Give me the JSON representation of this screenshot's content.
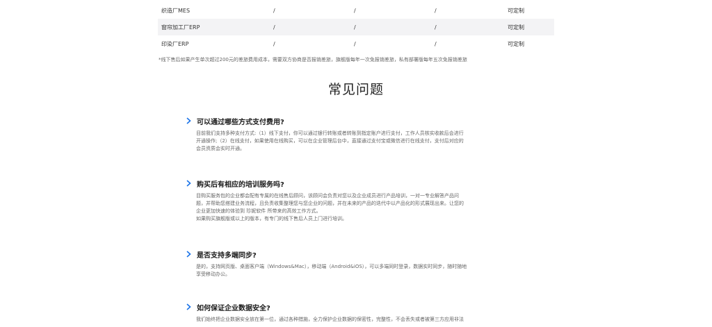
{
  "table": {
    "rows": [
      {
        "name": "织造厂MES",
        "a": "/",
        "b": "/",
        "c": "/",
        "d": "可定制"
      },
      {
        "name": "窗帘加工厂ERP",
        "a": "/",
        "b": "/",
        "c": "/",
        "d": "可定制"
      },
      {
        "name": "印染厂ERP",
        "a": "/",
        "b": "/",
        "c": "/",
        "d": "可定制"
      }
    ]
  },
  "footnote": "*线下售后如果产生单次超过200元的差旅费用成本，需要双方协商是否报销差旅，旗舰版每年一次免报销差旅，私有部署版每年五次免报销差旅",
  "faq_title": "常见问题",
  "faq": [
    {
      "question": "可以通过哪些方式支付费用?",
      "answer": [
        "目前我们支持多种支付方式:（1）线下支付，你可以通过银行转账或者转账到指定账户进行支付，工作人员核实收款后会进行",
        "开通操作;（2）在线支付，如果使用在线购买，可以在企业管理后台中，直接通过支付宝或微信进行在线支付，支付后对应的",
        "会员资质会实时开通。"
      ]
    },
    {
      "question": "购买后有相应的培训服务吗?",
      "answer": [
        "目购买服务包的企业都会配有专属的在线售后顾问，该顾问会负责对您以及企业成员进行产品培训，一对一专业解答产品问",
        "题，并帮助您搭建业务流程，且负责收集整理您与您企业的问题，并在未来的产品的迭代中以产品化的形式展现出来。让您的",
        "企业更加快速的体验到 珍妮软件 所带来的高效工作方式。",
        "如果购买旗舰版或以上的版本，有专门的线下售后人员上门进行培训。"
      ]
    },
    {
      "question": "是否支持多端同步?",
      "answer": [
        "是的，支持网页版、桌面客户端（Windows&Mac），移动端（Android&iOS），可以多端同时登录，数据实时同步，随时随地",
        "享受移动办公。"
      ]
    },
    {
      "question": "如何保证企业数据安全?",
      "answer": [
        "我们始终把企业数据安全放在第一位，通过各种措施，全力保护企业数据的保密性，完整性，不会丢失或者被第三方应用非法"
      ]
    }
  ],
  "colors": {
    "accent": "#1a73e8",
    "row_alt": "#f3f3f5"
  },
  "icons": {
    "faq_toggle": "chevron-right-icon"
  }
}
